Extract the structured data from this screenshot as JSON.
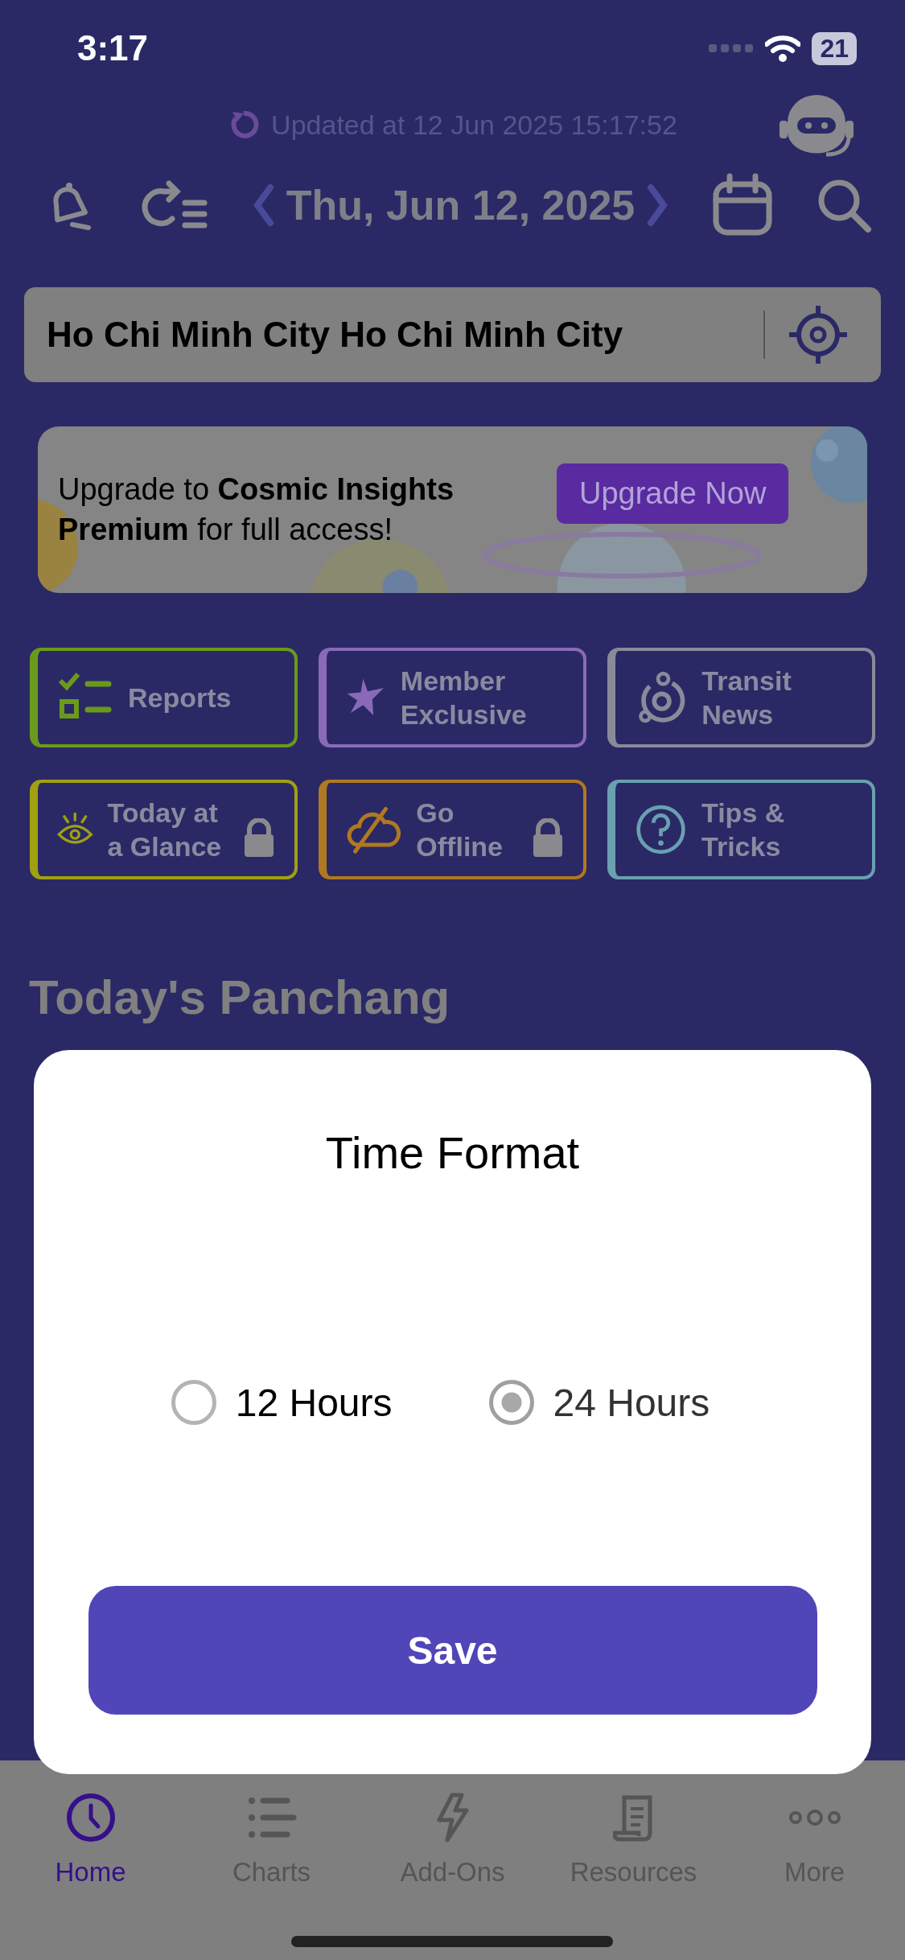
{
  "status_bar": {
    "time": "3:17",
    "battery": "21"
  },
  "update": {
    "text": "Updated at 12 Jun 2025 15:17:52"
  },
  "date_bar": {
    "date": "Thu, Jun 12, 2025"
  },
  "location": {
    "value": "Ho Chi Minh City Ho Chi Minh City"
  },
  "banner": {
    "text": "Upgrade to **Cosmic Insights Premium** for full access!",
    "button": "Upgrade Now"
  },
  "tiles": [
    {
      "label": "Reports",
      "color": "#6a9a1a",
      "locked": false,
      "kind": "checklist"
    },
    {
      "label": "Member Exclusive",
      "color": "#8a6ab8",
      "locked": false,
      "kind": "star"
    },
    {
      "label": "Transit News",
      "color": "#8a8a9a",
      "locked": false,
      "kind": "orbit"
    },
    {
      "label": "Today at a Glance",
      "color": "#a0a010",
      "locked": true,
      "kind": "eye"
    },
    {
      "label": "Go Offline",
      "color": "#b07820",
      "locked": true,
      "kind": "cloud"
    },
    {
      "label": "Tips & Tricks",
      "color": "#6aa0b0",
      "locked": false,
      "kind": "help"
    }
  ],
  "section_heading": "Today's Panchang",
  "dialog": {
    "title": "Time Format",
    "options": [
      {
        "label": "12 Hours",
        "selected": false
      },
      {
        "label": "24 Hours",
        "selected": true
      }
    ],
    "button": "Save"
  },
  "tab_bar": [
    {
      "label": "Home",
      "selected": true,
      "kind": "clock"
    },
    {
      "label": "Charts",
      "selected": false,
      "kind": "list"
    },
    {
      "label": "Add-Ons",
      "selected": false,
      "kind": "bolt"
    },
    {
      "label": "Resources",
      "selected": false,
      "kind": "scroll"
    },
    {
      "label": "More",
      "selected": false,
      "kind": "dots"
    }
  ]
}
